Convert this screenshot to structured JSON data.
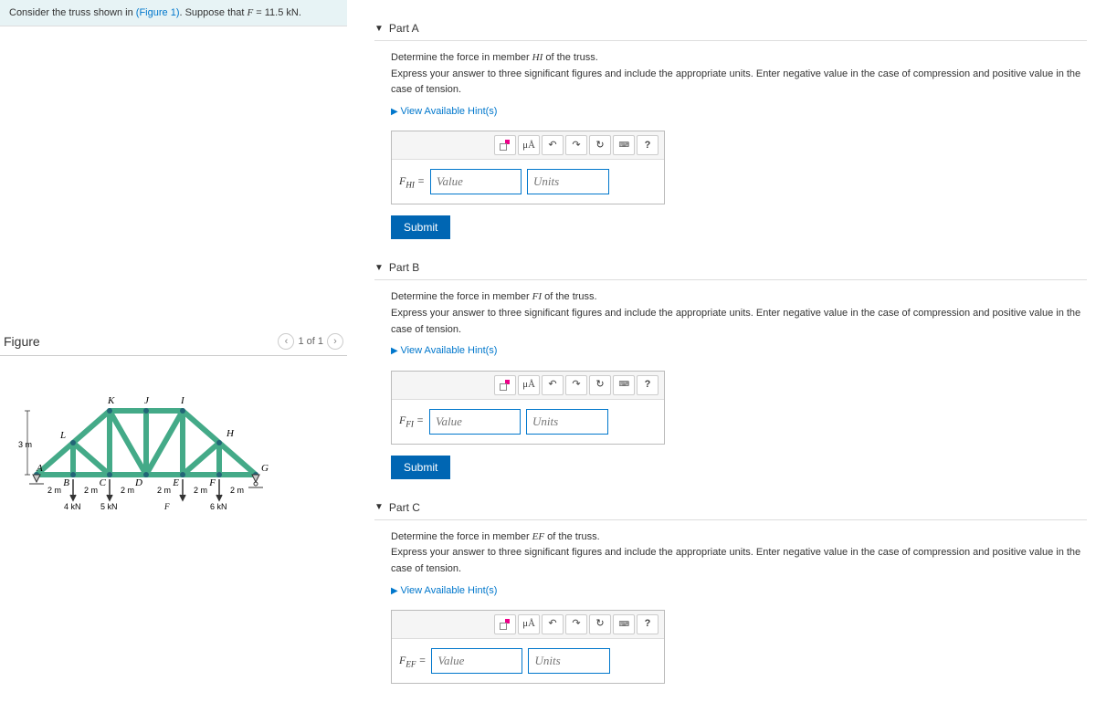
{
  "problem": {
    "text_prefix": "Consider the truss shown in ",
    "figure_ref": "(Figure 1)",
    "text_mid": ". Suppose that ",
    "var": "F",
    "text_suffix": " = 11.5 kN."
  },
  "figure": {
    "title": "Figure",
    "pager": "1 of 1",
    "labels": {
      "K": "K",
      "J": "J",
      "I": "I",
      "H": "H",
      "G": "G",
      "L": "L",
      "A": "A",
      "B": "B",
      "C": "C",
      "D": "D",
      "E": "E",
      "F_node": "F",
      "dim3m": "3 m",
      "dim2m": "2 m",
      "load4": "4 kN",
      "load5": "5 kN",
      "load6": "6 kN",
      "F_lbl": "F"
    }
  },
  "toolbar_icons": {
    "frac": "",
    "mua": "μÅ",
    "undo": "↶",
    "redo": "↷",
    "refresh": "↻",
    "kbd": "⌨",
    "help": "?"
  },
  "common": {
    "instructions": "Express your answer to three significant figures and include the appropriate units. Enter negative value in the case of compression and positive value in the case of tension.",
    "hints": "View Available Hint(s)",
    "value_ph": "Value",
    "units_ph": "Units",
    "submit": "Submit",
    "eq": " = "
  },
  "parts": {
    "A": {
      "title": "Part A",
      "prompt_prefix": "Determine the force in member ",
      "member": "HI",
      "prompt_suffix": " of the truss.",
      "force_sub": "HI"
    },
    "B": {
      "title": "Part B",
      "prompt_prefix": "Determine the force in member ",
      "member": "FI",
      "prompt_suffix": " of the truss.",
      "force_sub": "FI"
    },
    "C": {
      "title": "Part C",
      "prompt_prefix": "Determine the force in member ",
      "member": "EF",
      "prompt_suffix": " of the truss.",
      "force_sub": "EF"
    }
  }
}
